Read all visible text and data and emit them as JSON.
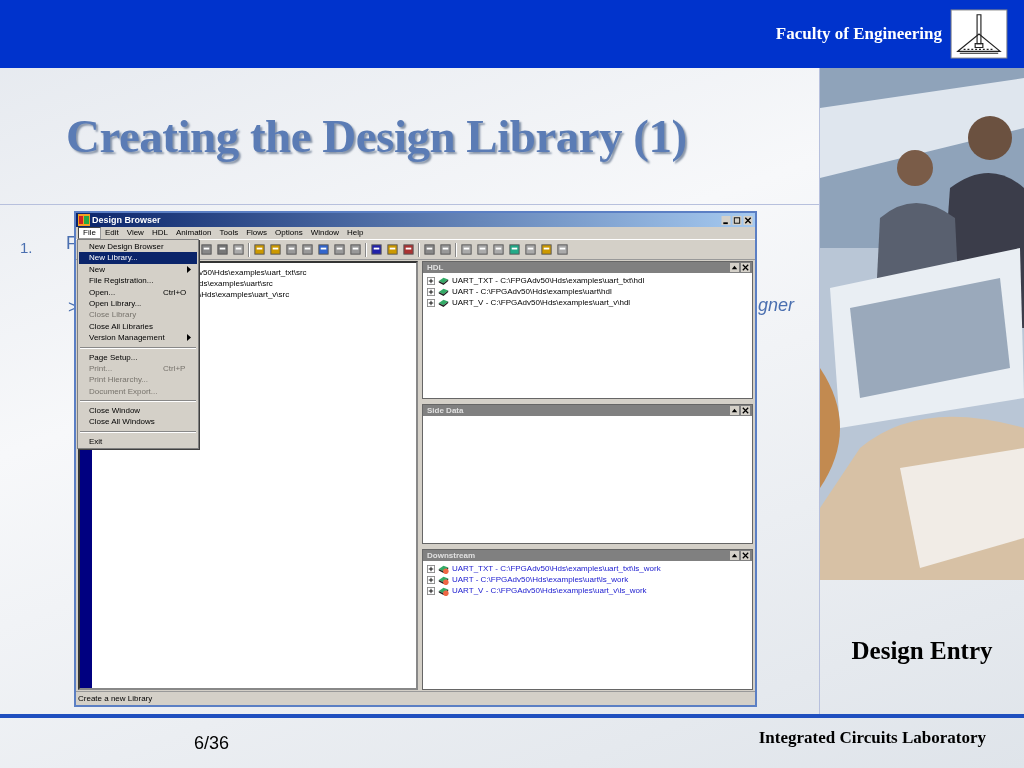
{
  "header": {
    "org": "Faculty of Engineering"
  },
  "title": "Creating the Design Library (1)",
  "fragments": [
    {
      "text": "1.",
      "kind": "number"
    },
    {
      "text": "F",
      "kind": "bullet"
    },
    {
      "text": ">",
      "kind": "sub"
    },
    {
      "text": "gner",
      "kind": "tail"
    }
  ],
  "window": {
    "title": "Design Browser",
    "menus": [
      {
        "label": "File",
        "selected": true
      },
      {
        "label": "Edit",
        "selected": false
      },
      {
        "label": "View",
        "selected": false
      },
      {
        "label": "HDL",
        "selected": false
      },
      {
        "label": "Animation",
        "selected": false
      },
      {
        "label": "Tools",
        "selected": false
      },
      {
        "label": "Flows",
        "selected": false
      },
      {
        "label": "Options",
        "selected": false
      },
      {
        "label": "Window",
        "selected": false
      },
      {
        "label": "Help",
        "selected": false
      }
    ],
    "file_menu": [
      {
        "kind": "item",
        "label": "New Design Browser",
        "selected": false,
        "disabled": false
      },
      {
        "kind": "item",
        "label": "New Library...",
        "selected": true,
        "disabled": false
      },
      {
        "kind": "submenu",
        "label": "New",
        "selected": false,
        "disabled": false
      },
      {
        "kind": "item",
        "label": "File Registration...",
        "selected": false,
        "disabled": false
      },
      {
        "kind": "item",
        "label": "Open...",
        "shortcut": "Ctrl+O",
        "selected": false,
        "disabled": false
      },
      {
        "kind": "item",
        "label": "Open Library...",
        "selected": false,
        "disabled": false
      },
      {
        "kind": "item",
        "label": "Close Library",
        "selected": false,
        "disabled": true
      },
      {
        "kind": "item",
        "label": "Close All Libraries",
        "selected": false,
        "disabled": false
      },
      {
        "kind": "submenu",
        "label": "Version Management",
        "selected": false,
        "disabled": false
      },
      {
        "kind": "separator"
      },
      {
        "kind": "item",
        "label": "Page Setup...",
        "selected": false,
        "disabled": false
      },
      {
        "kind": "item",
        "label": "Print...",
        "shortcut": "Ctrl+P",
        "selected": false,
        "disabled": true
      },
      {
        "kind": "item",
        "label": "Print Hierarchy...",
        "selected": false,
        "disabled": true
      },
      {
        "kind": "item",
        "label": "Document Export...",
        "selected": false,
        "disabled": true
      },
      {
        "kind": "separator"
      },
      {
        "kind": "item",
        "label": "Close Window",
        "selected": false,
        "disabled": false
      },
      {
        "kind": "item",
        "label": "Close All Windows",
        "selected": false,
        "disabled": false
      },
      {
        "kind": "separator"
      },
      {
        "kind": "item",
        "label": "Exit",
        "selected": false,
        "disabled": false
      }
    ],
    "left_pane": {
      "lines": [
        "v50\\Hds\\examples\\uart_txt\\src",
        "ds\\examples\\uart\\src",
        "\\Hds\\examples\\uart_v\\src"
      ]
    },
    "panes": [
      {
        "title": "HDL",
        "items": [
          {
            "label": "UART_TXT - C:\\FPGAdv50\\Hds\\examples\\uart_txt\\hdl",
            "kind": "hdl"
          },
          {
            "label": "UART - C:\\FPGAdv50\\Hds\\examples\\uart\\hdl",
            "kind": "hdl"
          },
          {
            "label": "UART_V - C:\\FPGAdv50\\Hds\\examples\\uart_v\\hdl",
            "kind": "hdl"
          }
        ]
      },
      {
        "title": "Side Data"
      },
      {
        "title": "Downstream",
        "items": [
          {
            "label": "UART_TXT - C:\\FPGAdv50\\Hds\\examples\\uart_txt\\ls_work",
            "kind": "downstream"
          },
          {
            "label": "UART - C:\\FPGAdv50\\Hds\\examples\\uart\\ls_work",
            "kind": "downstream"
          },
          {
            "label": "UART_V - C:\\FPGAdv50\\Hds\\examples\\uart_v\\ls_work",
            "kind": "downstream"
          }
        ]
      }
    ],
    "status_bar": "Create a new Library"
  },
  "side_label": "Design Entry",
  "footer": {
    "page": "6/36",
    "lab": "Integrated Circuits Laboratory"
  }
}
